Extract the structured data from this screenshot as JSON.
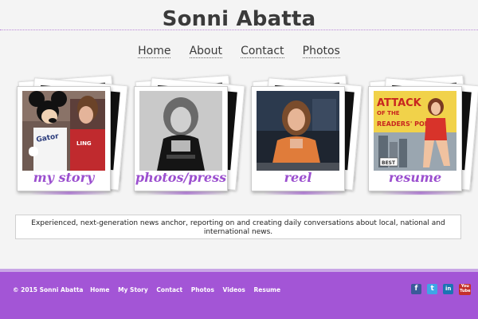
{
  "site": {
    "title": "Sonni Abatta"
  },
  "nav": {
    "items": [
      "Home",
      "About",
      "Contact",
      "Photos"
    ]
  },
  "cards": [
    {
      "caption": "my story"
    },
    {
      "caption": "photos/press"
    },
    {
      "caption": "reel"
    },
    {
      "caption": "resume"
    }
  ],
  "poster": {
    "line1": "ATTACK",
    "line2": "OF THE",
    "line3": "READERS' POLL",
    "sign": "BEST"
  },
  "tagline": "Experienced, next-generation news anchor, reporting on and creating daily conversations about local, national and international news.",
  "footer": {
    "copyright": "© 2015 Sonni Abatta",
    "links": [
      "Home",
      "My Story",
      "Contact",
      "Photos",
      "Videos",
      "Resume"
    ]
  },
  "social": {
    "facebook": "f",
    "twitter": "t",
    "linkedin": "in",
    "youtube": "You Tube"
  },
  "colors": {
    "accent": "#a355d6",
    "caption": "#9b4fcf",
    "background": "#f4f4f4"
  }
}
